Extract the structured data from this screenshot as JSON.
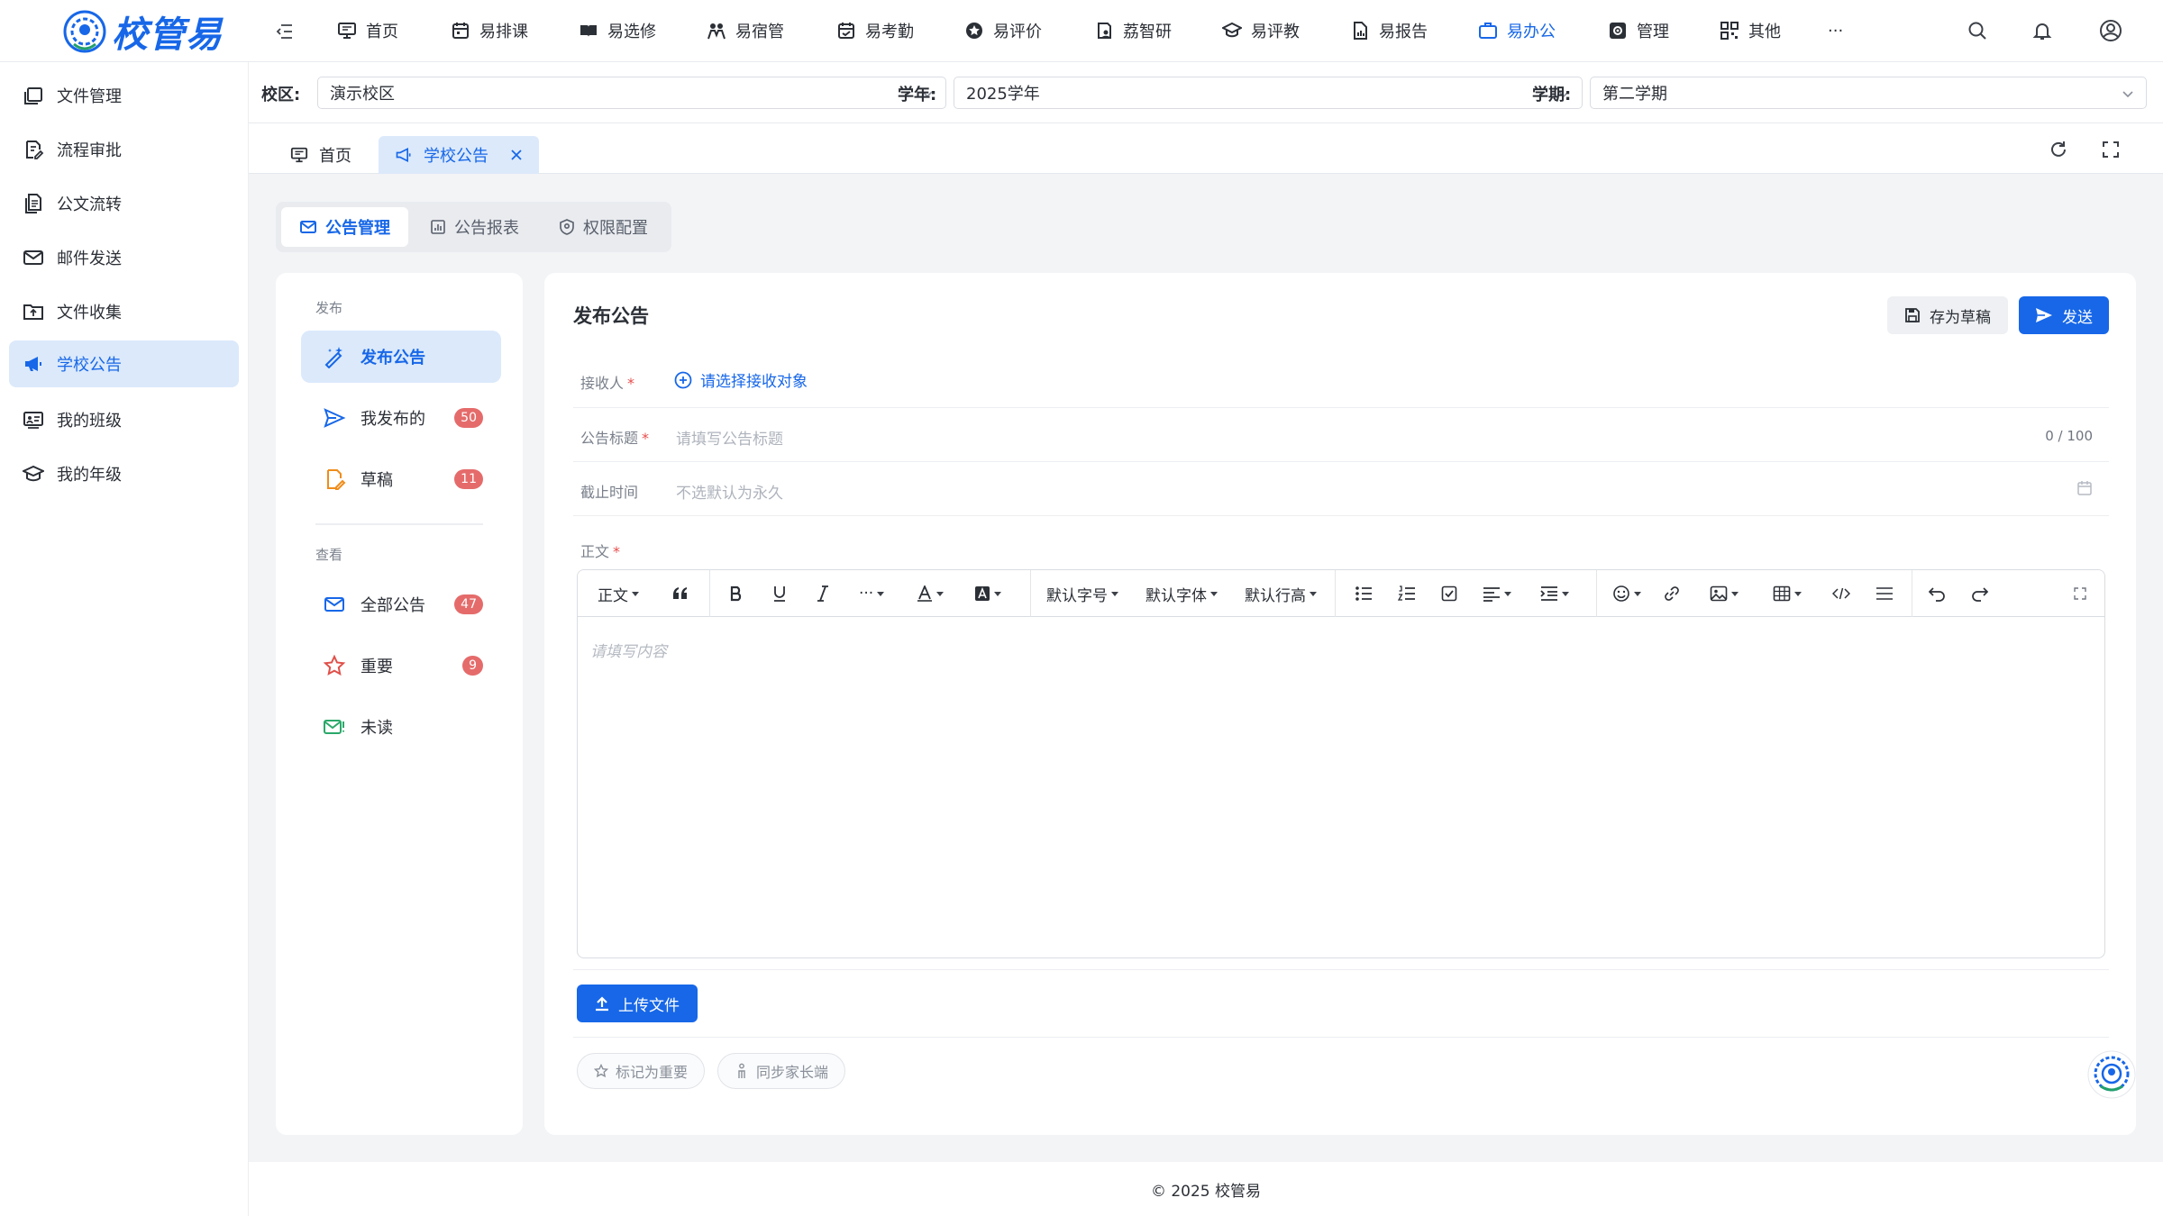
{
  "brand": {
    "name": "校管易",
    "accent": "#1767e8"
  },
  "topnav": [
    {
      "label": "首页",
      "icon": "monitor-icon"
    },
    {
      "label": "易排课",
      "icon": "calendar-icon"
    },
    {
      "label": "易选修",
      "icon": "book-open-icon"
    },
    {
      "label": "易宿管",
      "icon": "people-icon"
    },
    {
      "label": "易考勤",
      "icon": "calendar-check-icon"
    },
    {
      "label": "易评价",
      "icon": "star-circle-icon"
    },
    {
      "label": "荔智研",
      "icon": "clipboard-person-icon"
    },
    {
      "label": "易评教",
      "icon": "graduation-cap-icon"
    },
    {
      "label": "易报告",
      "icon": "report-icon"
    },
    {
      "label": "易办公",
      "icon": "briefcase-icon",
      "active": true
    },
    {
      "label": "管理",
      "icon": "gear-box-icon"
    },
    {
      "label": "其他",
      "icon": "grid-icon"
    },
    {
      "label": "···",
      "icon": "more-icon"
    }
  ],
  "sidebar": [
    {
      "label": "文件管理",
      "icon": "files-icon"
    },
    {
      "label": "流程审批",
      "icon": "doc-edit-icon"
    },
    {
      "label": "公文流转",
      "icon": "doc-copy-icon"
    },
    {
      "label": "邮件发送",
      "icon": "mail-icon"
    },
    {
      "label": "文件收集",
      "icon": "folder-upload-icon"
    },
    {
      "label": "学校公告",
      "icon": "megaphone-icon",
      "active": true
    },
    {
      "label": "我的班级",
      "icon": "class-board-icon"
    },
    {
      "label": "我的年级",
      "icon": "graduation-cap-icon"
    }
  ],
  "filters": {
    "campus_label": "校区:",
    "campus_value": "演示校区",
    "year_label": "学年:",
    "year_value": "2025学年",
    "term_label": "学期:",
    "term_value": "第二学期"
  },
  "pagetabs": {
    "home": "首页",
    "current": "学校公告"
  },
  "innertabs": [
    "公告管理",
    "公告报表",
    "权限配置"
  ],
  "leftmenu": {
    "group_publish": "发布",
    "group_view": "查看",
    "items": [
      {
        "label": "发布公告",
        "badge": ""
      },
      {
        "label": "我发布的",
        "badge": "50"
      },
      {
        "label": "草稿",
        "badge": "11"
      },
      {
        "label": "全部公告",
        "badge": "47"
      },
      {
        "label": "重要",
        "badge": "9"
      },
      {
        "label": "未读",
        "badge": ""
      }
    ]
  },
  "form": {
    "title": "发布公告",
    "draft_label": "存为草稿",
    "send_label": "发送",
    "recipient_label": "接收人",
    "recipient_action": "请选择接收对象",
    "title_label": "公告标题",
    "title_placeholder": "请填写公告标题",
    "title_count": "0 / 100",
    "deadline_label": "截止时间",
    "deadline_placeholder": "不选默认为永久",
    "body_label": "正文",
    "body_placeholder": "请填写内容",
    "upload_label": "上传文件",
    "mark_important": "标记为重要",
    "sync_parent": "同步家长端"
  },
  "editor_toolbar": {
    "paragraph": "正文",
    "font_size": "默认字号",
    "font_family": "默认字体",
    "line_height": "默认行高",
    "more": "···"
  },
  "footer": "© 2025 校管易"
}
